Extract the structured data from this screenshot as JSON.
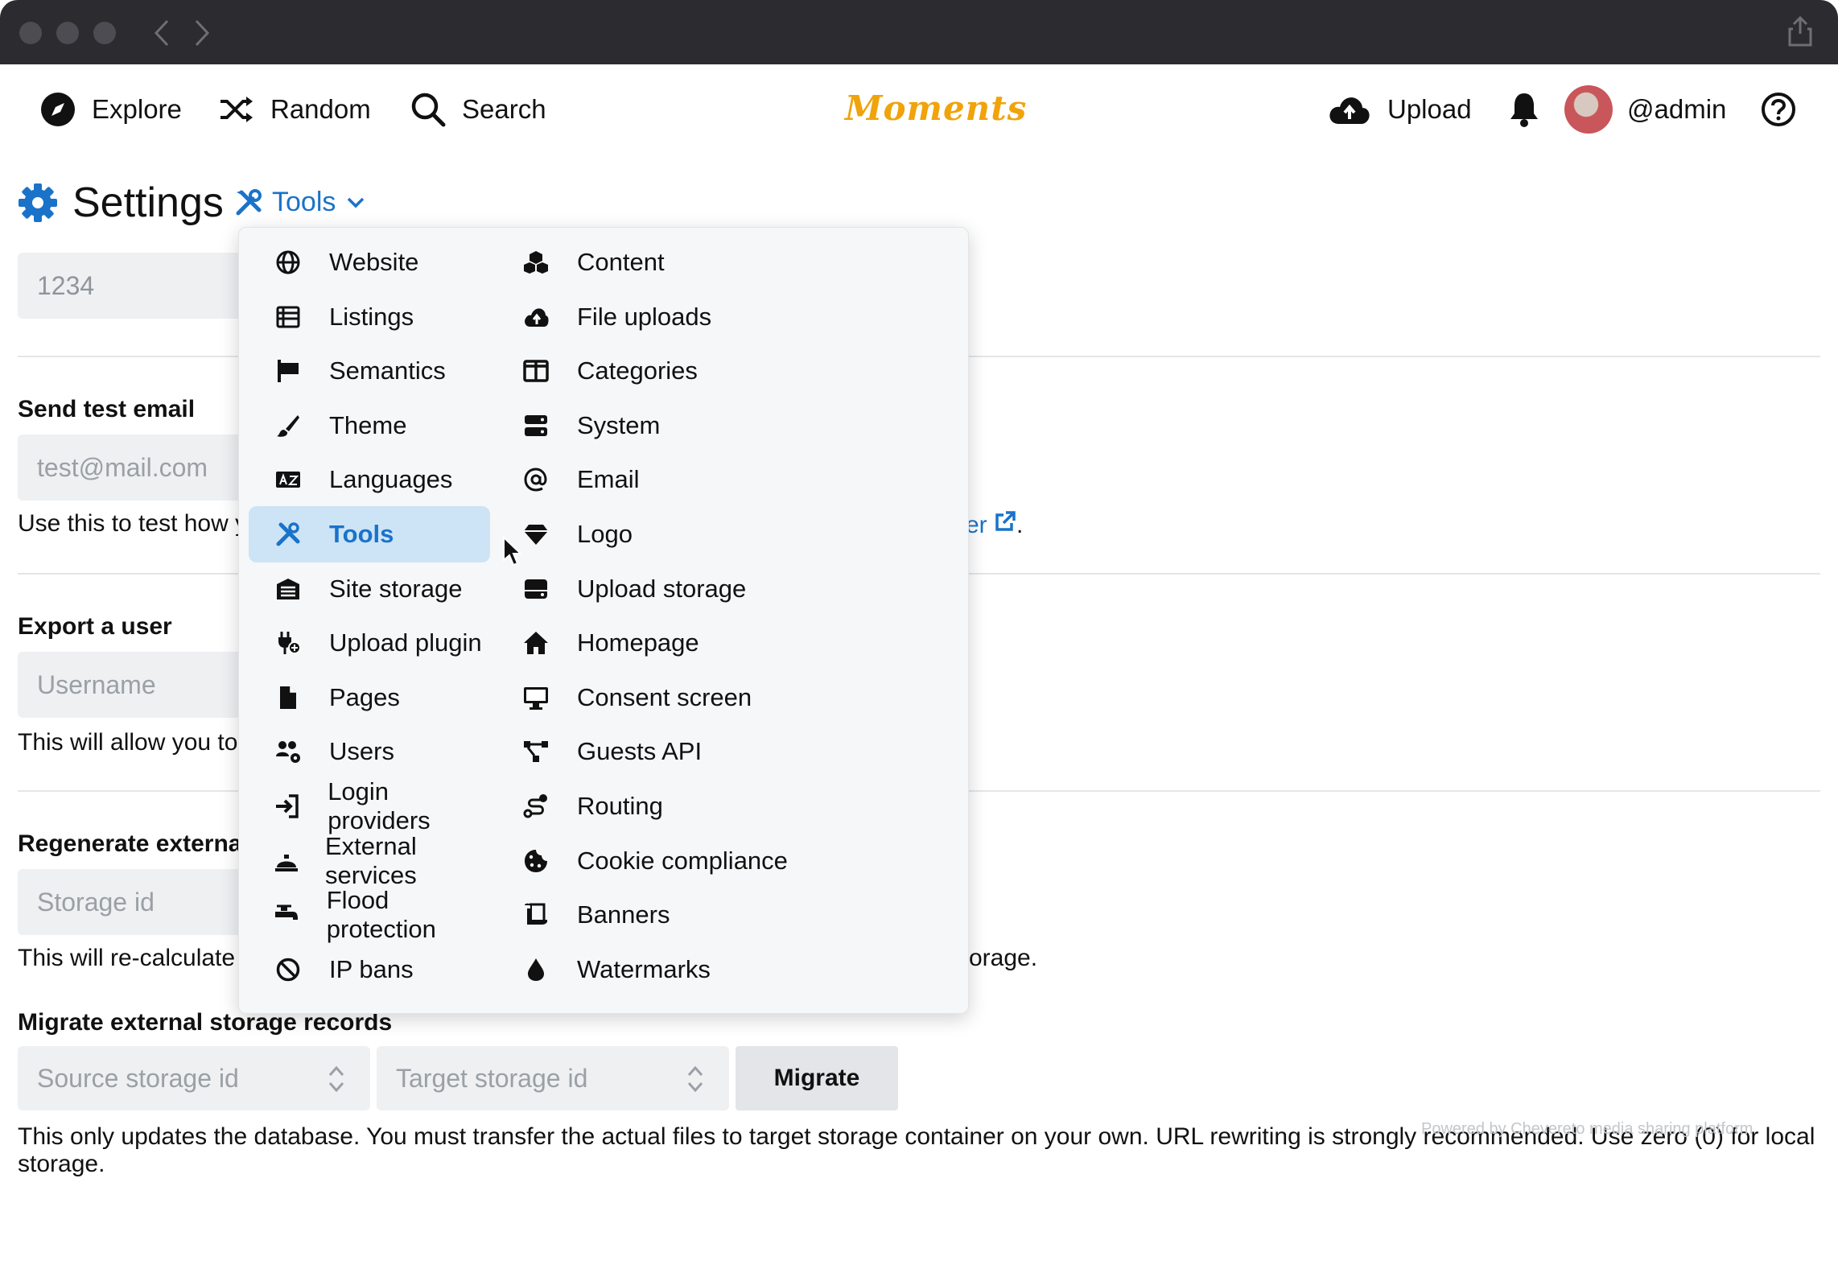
{
  "brand": "Moments",
  "topnav": {
    "explore": "Explore",
    "random": "Random",
    "search": "Search",
    "upload": "Upload",
    "user": "@admin"
  },
  "heading": {
    "title": "Settings",
    "section": "Tools"
  },
  "form": {
    "first_input_value": "1234",
    "send_test_email": {
      "label": "Send test email",
      "placeholder": "test@mail.com",
      "help_start": "Use this to test how y",
      "help_link_tail": "er",
      "help_end": "."
    },
    "export_user": {
      "label": "Export a user",
      "placeholder": "Username",
      "help": "This will allow you to"
    },
    "regenerate": {
      "label": "Regenerate externa",
      "placeholder": "Storage id",
      "help_start": "This will re-calculate",
      "help_end": "orage."
    },
    "migrate": {
      "label": "Migrate external storage records",
      "source_placeholder": "Source storage id",
      "target_placeholder": "Target storage id",
      "button": "Migrate",
      "help_line1": "This only updates the database. You must transfer the actual files to target storage container on your own. URL rewriting is strongly recommended. Use zero (0) for local",
      "help_line2": "storage."
    },
    "powered_by": "Powered by Chevereto media sharing platform"
  },
  "menu": {
    "left": [
      {
        "label": "Website",
        "icon": "globe-icon"
      },
      {
        "label": "Listings",
        "icon": "list-icon"
      },
      {
        "label": "Semantics",
        "icon": "flag-icon"
      },
      {
        "label": "Theme",
        "icon": "paintbrush-icon"
      },
      {
        "label": "Languages",
        "icon": "language-icon"
      },
      {
        "label": "Tools",
        "icon": "tools-icon",
        "active": true
      },
      {
        "label": "Site storage",
        "icon": "warehouse-icon"
      },
      {
        "label": "Upload plugin",
        "icon": "plug-icon"
      },
      {
        "label": "Pages",
        "icon": "file-icon"
      },
      {
        "label": "Users",
        "icon": "users-gear-icon"
      },
      {
        "label": "Login providers",
        "icon": "sign-in-icon"
      },
      {
        "label": "External services",
        "icon": "concierge-bell-icon"
      },
      {
        "label": "Flood protection",
        "icon": "faucet-icon"
      },
      {
        "label": "IP bans",
        "icon": "ban-icon"
      }
    ],
    "right": [
      {
        "label": "Content",
        "icon": "cubes-icon"
      },
      {
        "label": "File uploads",
        "icon": "cloud-upload-icon"
      },
      {
        "label": "Categories",
        "icon": "columns-icon"
      },
      {
        "label": "System",
        "icon": "server-icon"
      },
      {
        "label": "Email",
        "icon": "at-icon"
      },
      {
        "label": "Logo",
        "icon": "gem-icon"
      },
      {
        "label": "Upload storage",
        "icon": "hdd-icon"
      },
      {
        "label": "Homepage",
        "icon": "home-icon"
      },
      {
        "label": "Consent screen",
        "icon": "desktop-icon"
      },
      {
        "label": "Guests API",
        "icon": "nodes-icon"
      },
      {
        "label": "Routing",
        "icon": "route-icon"
      },
      {
        "label": "Cookie compliance",
        "icon": "cookie-icon"
      },
      {
        "label": "Banners",
        "icon": "scroll-icon"
      },
      {
        "label": "Watermarks",
        "icon": "droplet-icon"
      }
    ]
  },
  "colors": {
    "accent": "#1a73c9",
    "brand": "#f0a30a",
    "active_bg": "#cde4f6"
  }
}
